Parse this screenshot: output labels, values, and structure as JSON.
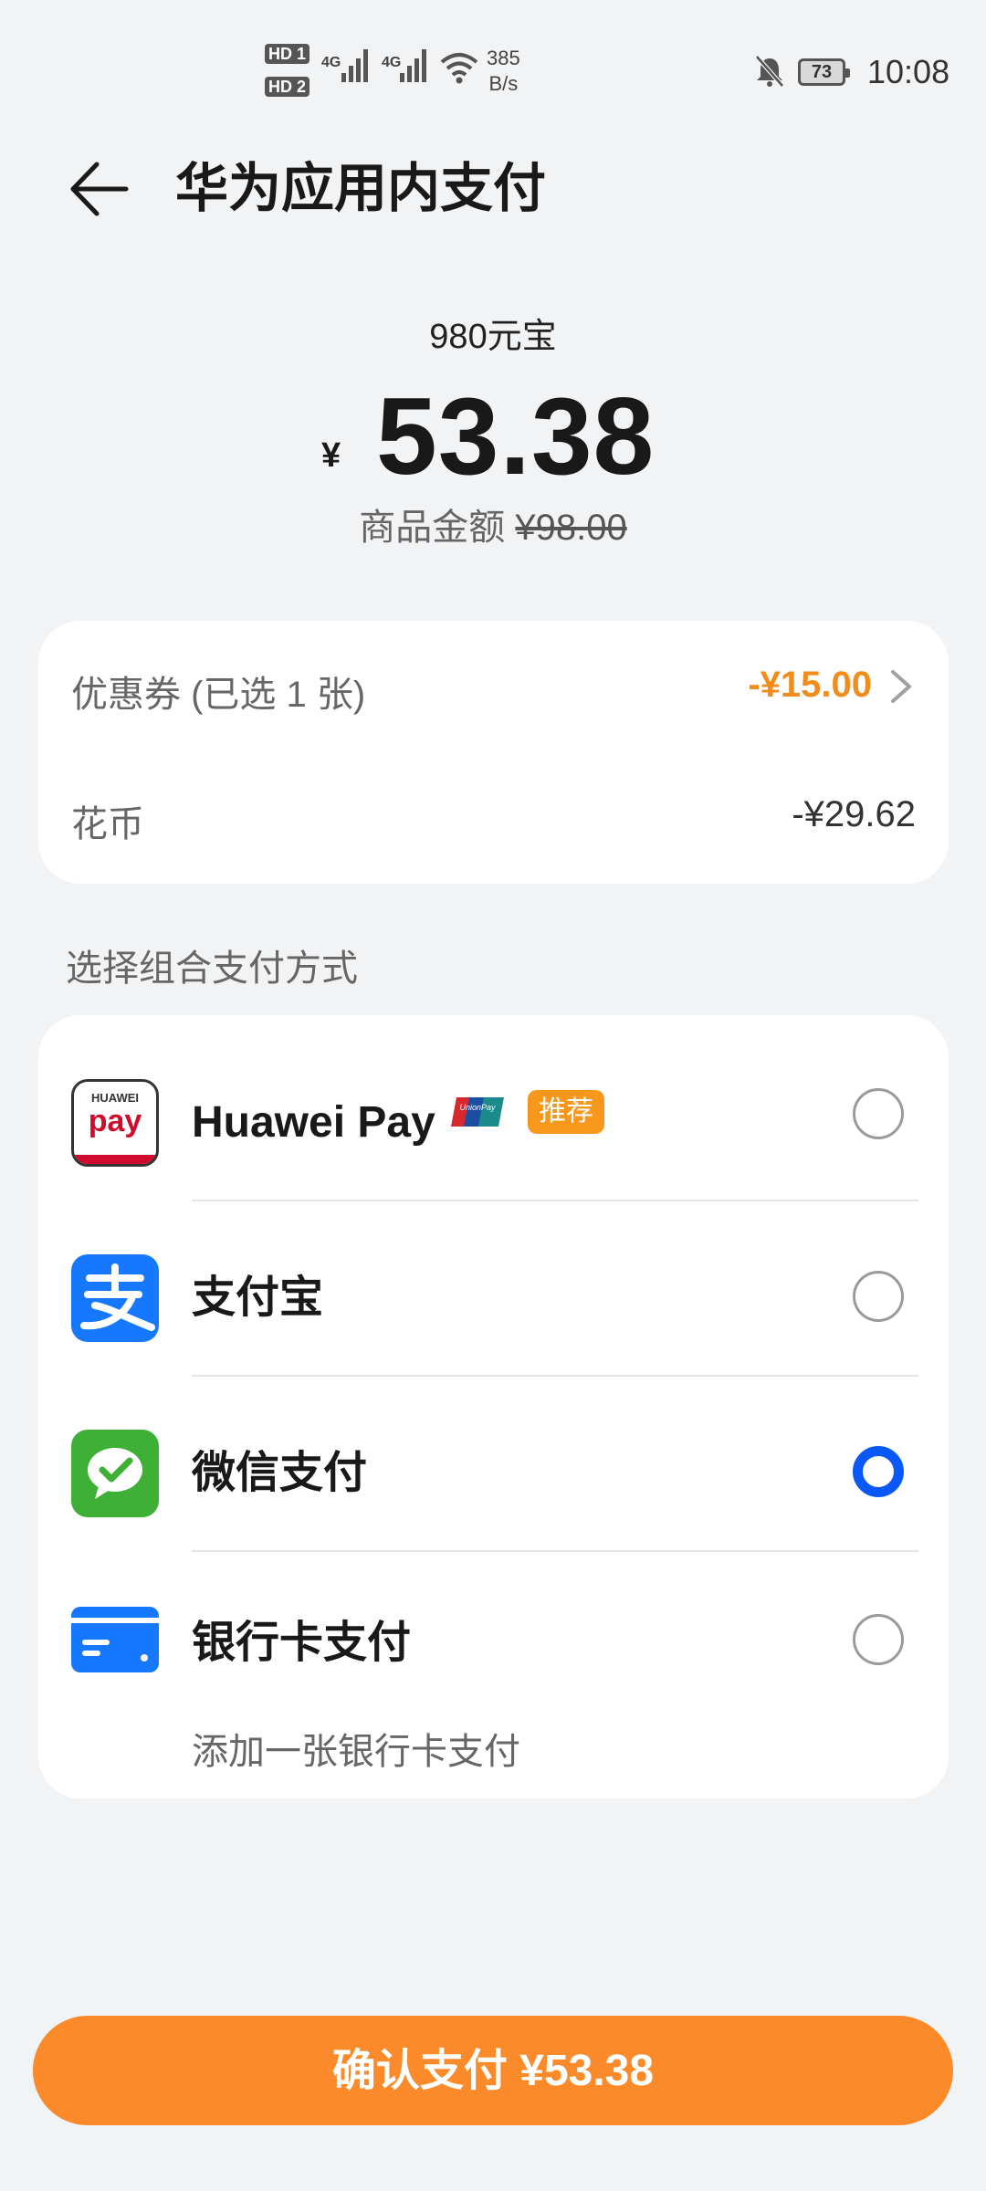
{
  "status_bar": {
    "hd1": "HD",
    "hd1_num": "1",
    "hd2": "HD",
    "hd2_num": "2",
    "sig1_label": "4G",
    "sig2_label": "4G",
    "net_speed_value": "385",
    "net_speed_unit": "B/s",
    "battery": "73",
    "time": "10:08"
  },
  "header": {
    "title": "华为应用内支付"
  },
  "summary": {
    "product": "980元宝",
    "currency": "¥",
    "amount": "53.38",
    "original_label": "商品金额",
    "original_price": "¥98.00"
  },
  "discounts": {
    "coupon_label": "优惠券 (已选 1 张)",
    "coupon_value": "-¥15.00",
    "coins_label": "花币",
    "coins_value": "-¥29.62"
  },
  "methods_title": "选择组合支付方式",
  "methods": [
    {
      "name": "Huawei Pay",
      "selected": false,
      "icon": "huawei-pay-icon",
      "badge": "推荐",
      "badge_extra": "unionpay-icon"
    },
    {
      "name": "支付宝",
      "selected": false,
      "icon": "alipay-icon"
    },
    {
      "name": "微信支付",
      "selected": true,
      "icon": "wechat-pay-icon"
    },
    {
      "name": "银行卡支付",
      "selected": false,
      "icon": "bank-card-icon",
      "subtitle": "添加一张银行卡支付"
    }
  ],
  "icon_text": {
    "huawei_top": "HUAWEI",
    "huawei_bottom": "pay",
    "unionpay": "UnionPay"
  },
  "confirm_button": "确认支付 ¥53.38",
  "colors": {
    "accent_orange": "#fb8a2a",
    "coupon_orange": "#f28c1a",
    "selected_blue": "#0a59f7",
    "alipay_blue": "#1677ff",
    "wechat_green": "#3db035",
    "bank_blue": "#1677ff"
  }
}
